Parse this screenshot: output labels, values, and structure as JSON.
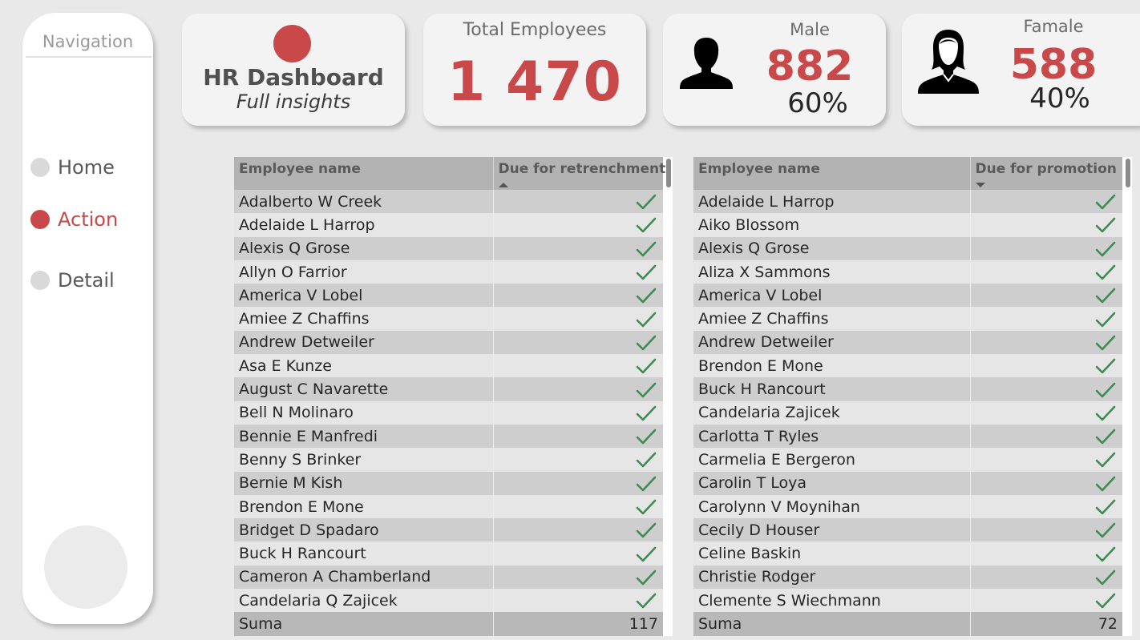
{
  "navigation": {
    "title": "Navigation",
    "items": [
      {
        "label": "Home",
        "active": false
      },
      {
        "label": "Action",
        "active": true
      },
      {
        "label": "Detail",
        "active": false
      }
    ]
  },
  "header_card": {
    "title": "HR Dashboard",
    "subtitle": "Full insights"
  },
  "total_card": {
    "label": "Total Employees",
    "value": "1 470"
  },
  "male_card": {
    "label": "Male",
    "value": "882",
    "percent": "60%",
    "icon": "male-user-icon"
  },
  "female_card": {
    "label": "Famale",
    "value": "588",
    "percent": "40%",
    "icon": "female-user-icon"
  },
  "colors": {
    "accent": "#c9484a",
    "check": "#3f8a55"
  },
  "retrenchment_table": {
    "columns": [
      "Employee name",
      "Due for retrenchment"
    ],
    "sort": "ascending",
    "rows": [
      "Adalberto W Creek",
      "Adelaide L Harrop",
      "Alexis Q Grose",
      "Allyn O Farrior",
      "America V Lobel",
      "Amiee Z Chaffins",
      "Andrew Detweiler",
      "Asa E Kunze",
      "August C Navarette",
      "Bell N Molinaro",
      "Bennie E Manfredi",
      "Benny S Brinker",
      "Bernie M Kish",
      "Brendon E Mone",
      "Bridget D Spadaro",
      "Buck H Rancourt",
      "Cameron A Chamberland",
      "Candelaria Q Zajicek"
    ],
    "total_label": "Suma",
    "total_value": "117"
  },
  "promotion_table": {
    "columns": [
      "Employee name",
      "Due for promotion"
    ],
    "sort": "descending",
    "rows": [
      "Adelaide L Harrop",
      "Aiko Blossom",
      "Alexis Q Grose",
      "Aliza X Sammons",
      "America V Lobel",
      "Amiee Z Chaffins",
      "Andrew Detweiler",
      "Brendon E Mone",
      "Buck H Rancourt",
      "Candelaria Zajicek",
      "Carlotta T Ryles",
      "Carmelia E Bergeron",
      "Carolin T Loya",
      "Carolynn V Moynihan",
      "Cecily D Houser",
      "Celine Baskin",
      "Christie Rodger",
      "Clemente S Wiechmann"
    ],
    "total_label": "Suma",
    "total_value": "72"
  }
}
